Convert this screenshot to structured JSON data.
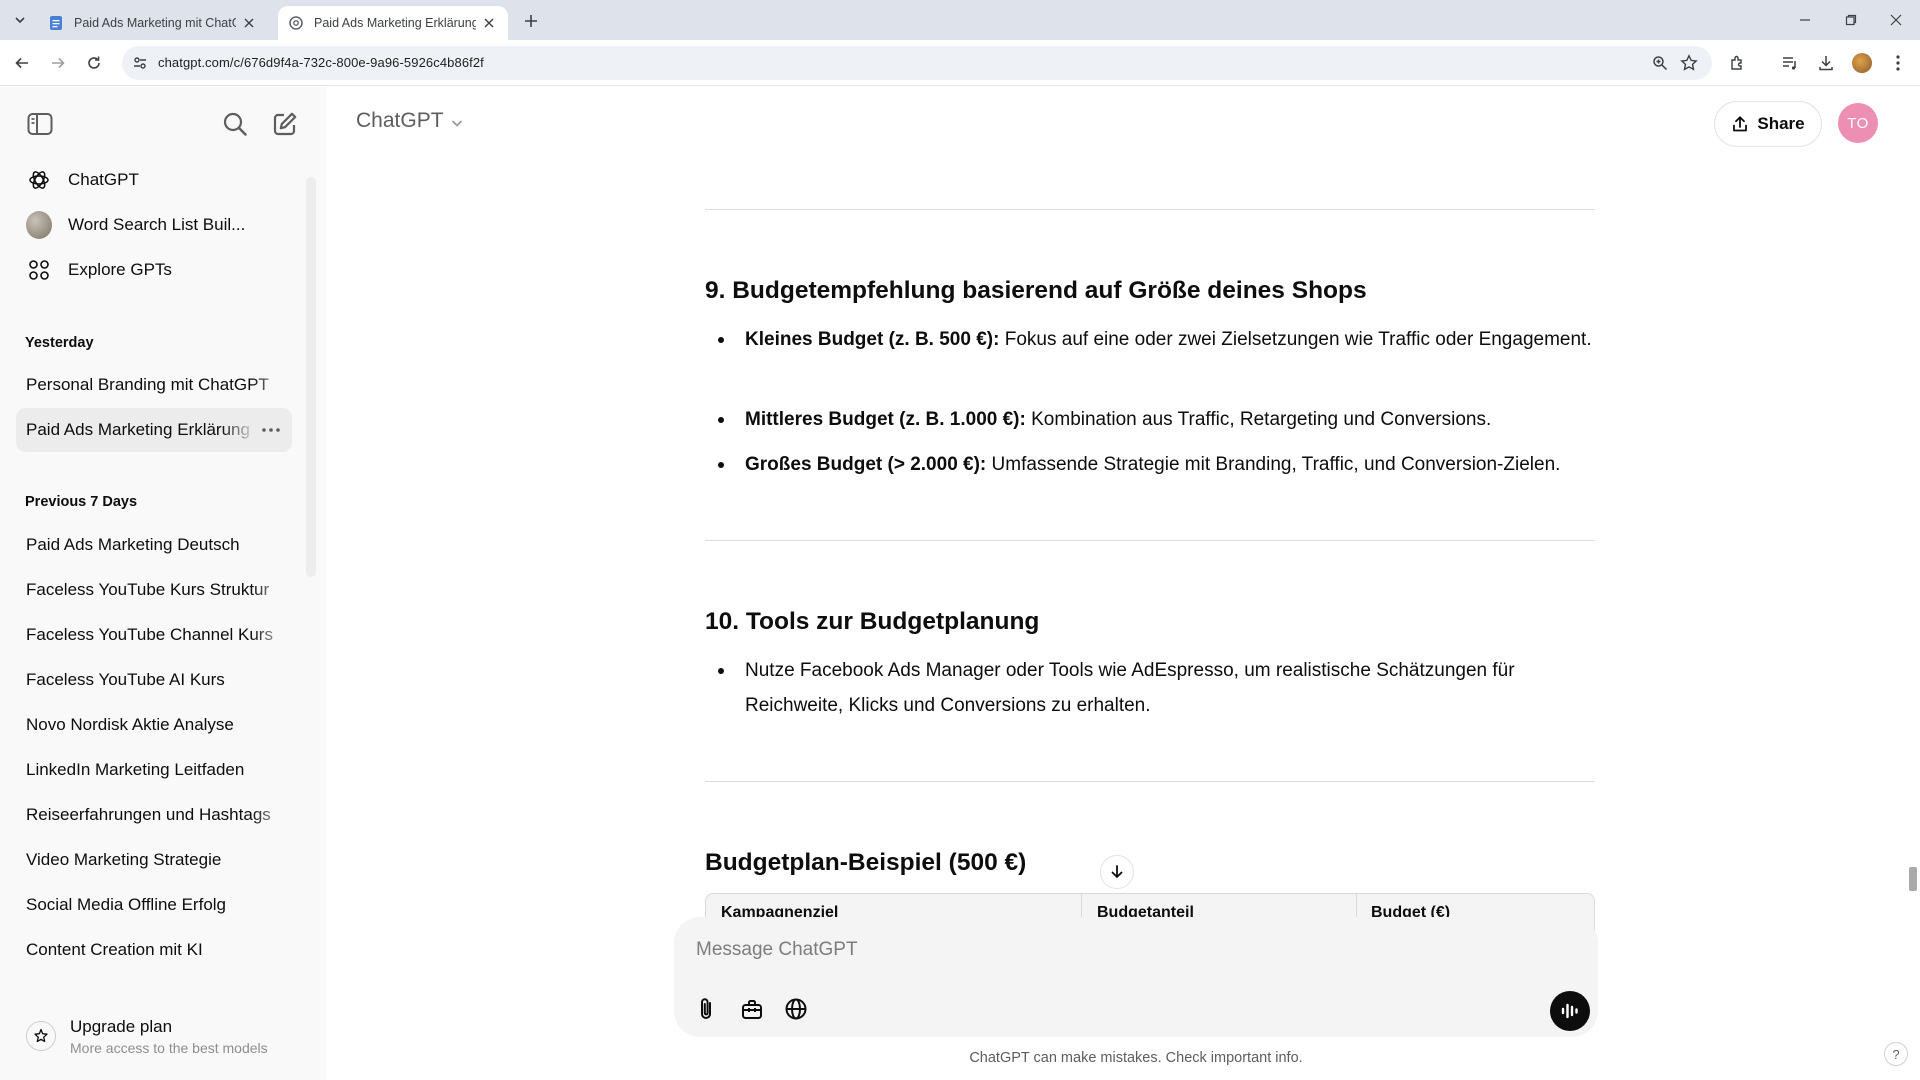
{
  "browser": {
    "tabs": [
      {
        "title": "Paid Ads Marketing mit ChatGPT",
        "active": false
      },
      {
        "title": "Paid Ads Marketing Erklärung",
        "active": true
      }
    ],
    "url": "chatgpt.com/c/676d9f4a-732c-800e-9a96-5926c4b86f2f"
  },
  "sidebar": {
    "nav": [
      {
        "label": "ChatGPT",
        "icon": "openai-logo-icon"
      },
      {
        "label": "Word Search List Buil...",
        "icon": "gpt-avatar"
      },
      {
        "label": "Explore GPTs",
        "icon": "grid-icon"
      }
    ],
    "sections": [
      {
        "title": "Yesterday",
        "chats": [
          "Personal Branding mit ChatGPT",
          "Paid Ads Marketing Erklärung"
        ]
      },
      {
        "title": "Previous 7 Days",
        "chats": [
          "Paid Ads Marketing Deutsch",
          "Faceless YouTube Kurs Struktur",
          "Faceless YouTube Channel Kurs",
          "Faceless YouTube AI Kurs",
          "Novo Nordisk Aktie Analyse",
          "LinkedIn Marketing Leitfaden",
          "Reiseerfahrungen und Hashtags",
          "Video Marketing Strategie",
          "Social Media Offline Erfolg",
          "Content Creation mit KI"
        ]
      }
    ],
    "selected_chat": "Paid Ads Marketing Erklärung",
    "upgrade": {
      "title": "Upgrade plan",
      "subtitle": "More access to the best models"
    }
  },
  "header": {
    "model": "ChatGPT",
    "share_label": "Share",
    "user_initials": "TO"
  },
  "content": {
    "section9": {
      "heading": "9. Budgetempfehlung basierend auf Größe deines Shops",
      "items": [
        {
          "bold": "Kleines Budget (z. B. 500 €):",
          "text": " Fokus auf eine oder zwei Zielsetzungen wie Traffic oder Engagement."
        },
        {
          "bold": "Mittleres Budget (z. B. 1.000 €):",
          "text": " Kombination aus Traffic, Retargeting und Conversions."
        },
        {
          "bold": "Großes Budget (> 2.000 €):",
          "text": " Umfassende Strategie mit Branding, Traffic, und Conversion-Zielen."
        }
      ]
    },
    "section10": {
      "heading": "10. Tools zur Budgetplanung",
      "items": [
        {
          "text": "Nutze Facebook Ads Manager oder Tools wie AdEspresso, um realistische Schätzungen für Reichweite, Klicks und Conversions zu erhalten."
        }
      ]
    },
    "example": {
      "heading": "Budgetplan-Beispiel (500 €)",
      "columns": [
        "Kampagnenziel",
        "Budgetanteil",
        "Budget (€)"
      ]
    }
  },
  "composer": {
    "placeholder": "Message ChatGPT",
    "disclaimer": "ChatGPT can make mistakes. Check important info."
  },
  "colors": {
    "accent_avatar": "#ec8fb3",
    "sidebar_bg": "#f9f9f9",
    "tabstrip_bg": "#dee3eb"
  }
}
